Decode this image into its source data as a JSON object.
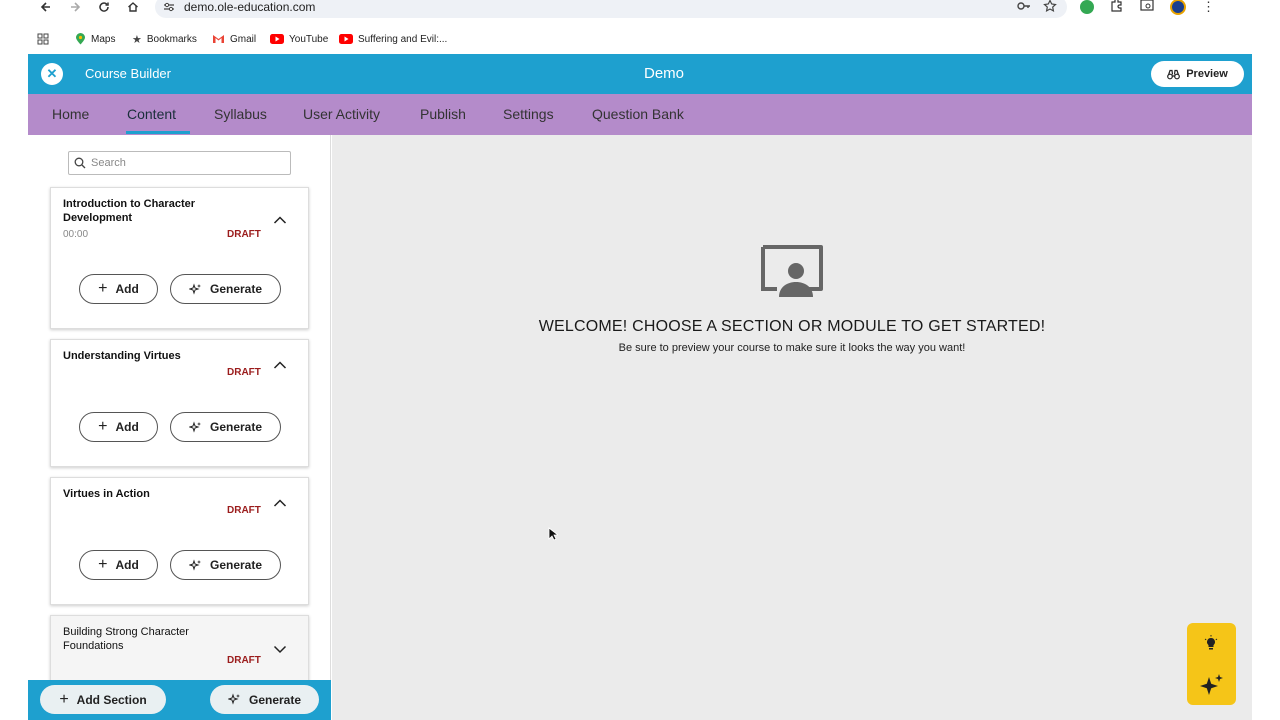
{
  "browser": {
    "url": "demo.ole-education.com",
    "bookmarks": [
      {
        "label": "Maps"
      },
      {
        "label": "Bookmarks"
      },
      {
        "label": "Gmail"
      },
      {
        "label": "YouTube"
      },
      {
        "label": "Suffering and Evil:..."
      }
    ]
  },
  "header": {
    "app_title": "Course Builder",
    "course_title": "Demo",
    "preview_label": "Preview"
  },
  "tabs": [
    {
      "label": "Home"
    },
    {
      "label": "Content",
      "active": true
    },
    {
      "label": "Syllabus"
    },
    {
      "label": "User Activity"
    },
    {
      "label": "Publish"
    },
    {
      "label": "Settings"
    },
    {
      "label": "Question Bank"
    }
  ],
  "sidebar": {
    "search_placeholder": "Search",
    "sections": [
      {
        "title": "Introduction to Character Development",
        "time": "00:00",
        "status": "DRAFT",
        "expanded": true
      },
      {
        "title": "Understanding Virtues",
        "status": "DRAFT",
        "expanded": true
      },
      {
        "title": "Virtues in Action",
        "status": "DRAFT",
        "expanded": true
      },
      {
        "title": "Building Strong Character Foundations",
        "status": "DRAFT",
        "expanded": false
      }
    ],
    "add_label": "Add",
    "generate_label": "Generate",
    "add_section_label": "Add Section",
    "bottom_generate_label": "Generate"
  },
  "main": {
    "welcome_title": "WELCOME! CHOOSE A SECTION OR MODULE TO GET STARTED!",
    "welcome_subtitle": "Be sure to preview your course to make sure it looks the way you want!"
  },
  "colors": {
    "header_blue": "#1ea0cf",
    "tab_purple": "#b48bca",
    "draft_red": "#9b1c1c",
    "assistant_yellow": "#f5c518"
  }
}
